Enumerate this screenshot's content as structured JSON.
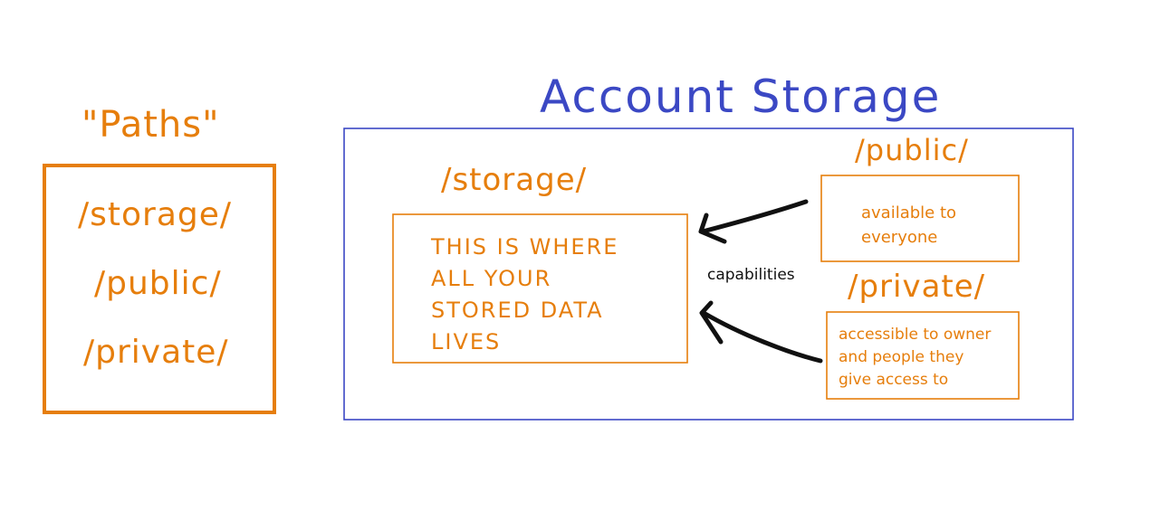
{
  "colors": {
    "orange": "#e67e0c",
    "blue": "#3b48c4",
    "arrow": "#111111"
  },
  "paths_panel": {
    "title": "\"Paths\"",
    "items": [
      "/storage/",
      "/public/",
      "/private/"
    ]
  },
  "account_storage": {
    "title": "Account Storage",
    "storage": {
      "label": "/storage/",
      "description": "THIS IS WHERE\nALL YOUR\nSTORED DATA\nLIVES"
    },
    "public": {
      "label": "/public/",
      "description": "available to\neveryone"
    },
    "private": {
      "label": "/private/",
      "description": "accessible to owner\nand people they\ngive access to"
    },
    "arrow_label": "capabilities"
  }
}
